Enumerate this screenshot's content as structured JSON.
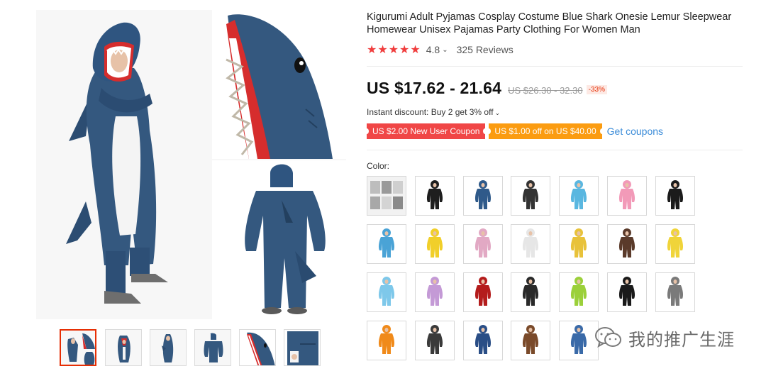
{
  "product": {
    "title": "Kigurumi Adult Pyjamas Cosplay Costume Blue Shark Onesie Lemur Sleepwear Homewear Unisex Pajamas Party Clothing For Women Man",
    "stars": [
      "★",
      "★",
      "★",
      "★",
      "★"
    ],
    "rating": "4.8",
    "rating_chevron": "⌄",
    "reviews": "325 Reviews",
    "price": "US $17.62 - 21.64",
    "original_price": "US $26.30 - 32.30",
    "discount": "-33%",
    "instant_discount": "Instant discount: Buy 2 get 3% off",
    "instant_chevron": "⌄",
    "coupons": [
      {
        "label": "US $2.00 New User Coupon",
        "color": "#f04646"
      },
      {
        "label": "US $1.00 off on US $40.00",
        "color": "#fb9c11"
      }
    ],
    "get_coupons": "Get coupons",
    "color_label": "Color:"
  },
  "gallery": {
    "selected_index": 0,
    "thumbnail_count": 6
  },
  "color_options": [
    {
      "icon": "grid-photo",
      "color": "#8a8a8a"
    },
    {
      "icon": "black-onesie",
      "color": "#1e1e1e"
    },
    {
      "icon": "blue-shark-onesie",
      "color": "#2f5a8a"
    },
    {
      "icon": "panda-onesie",
      "color": "#333333"
    },
    {
      "icon": "light-blue-onesie",
      "color": "#5ab7e0"
    },
    {
      "icon": "pink-unicorn-onesie",
      "color": "#f29ab8"
    },
    {
      "icon": "black-dark-onesie",
      "color": "#1b1b1b"
    },
    {
      "icon": "blue-stitch-onesie",
      "color": "#4aa3d6"
    },
    {
      "icon": "minion-onesie",
      "color": "#f1cf2a"
    },
    {
      "icon": "pink-onesie",
      "color": "#e2a9c4"
    },
    {
      "icon": "white-panda-onesie",
      "color": "#e6e6e6"
    },
    {
      "icon": "giraffe-onesie",
      "color": "#e8c23a"
    },
    {
      "icon": "brown-white-onesie",
      "color": "#5a3a2a"
    },
    {
      "icon": "yellow-pikachu-onesie",
      "color": "#f0d43a"
    },
    {
      "icon": "light-blue-onesie-2",
      "color": "#7ec8ea"
    },
    {
      "icon": "purple-onesie",
      "color": "#c49ad6"
    },
    {
      "icon": "red-black-onesie",
      "color": "#b41c1c"
    },
    {
      "icon": "black-white-onesie",
      "color": "#2a2a2a"
    },
    {
      "icon": "green-onesie",
      "color": "#9bd03a"
    },
    {
      "icon": "black-cat-onesie",
      "color": "#1a1a1a"
    },
    {
      "icon": "gray-husky-onesie",
      "color": "#7a7a7a"
    },
    {
      "icon": "orange-onesie",
      "color": "#f08a1a"
    },
    {
      "icon": "dark-gray-onesie",
      "color": "#3a3a3a"
    },
    {
      "icon": "blue-navy-onesie",
      "color": "#2a4e86"
    },
    {
      "icon": "brown-bear-onesie",
      "color": "#7a4a2a"
    },
    {
      "icon": "blue-shark-onesie-2",
      "color": "#3a6aa8"
    }
  ],
  "watermark": {
    "text": "我的推广生涯",
    "icon": "wechat-icon"
  }
}
